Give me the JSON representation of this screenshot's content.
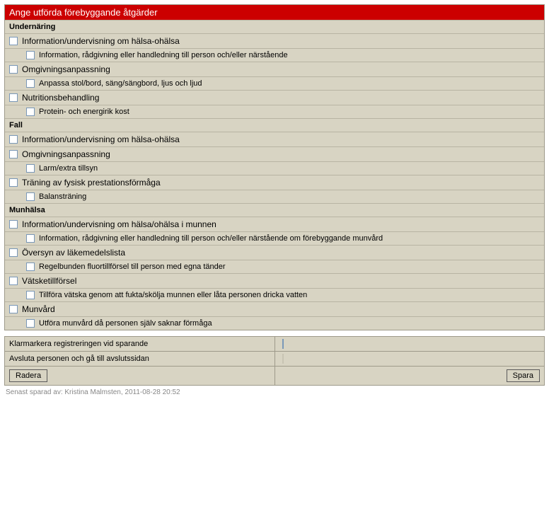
{
  "header": {
    "title": "Ange utförda förebyggande åtgärder"
  },
  "sections": {
    "undernaring": {
      "title": "Undernäring",
      "items": [
        {
          "label": "Information/undervisning om hälsa-ohälsa",
          "sub": [
            {
              "label": "Information, rådgivning eller handledning till person och/eller närstående"
            }
          ]
        },
        {
          "label": "Omgivningsanpassning",
          "sub": [
            {
              "label": "Anpassa stol/bord, säng/sängbord, ljus och ljud"
            }
          ]
        },
        {
          "label": "Nutritionsbehandling",
          "sub": [
            {
              "label": "Protein- och energirik kost"
            }
          ]
        }
      ]
    },
    "fall": {
      "title": "Fall",
      "items": [
        {
          "label": "Information/undervisning om hälsa-ohälsa",
          "sub": []
        },
        {
          "label": "Omgivningsanpassning",
          "sub": [
            {
              "label": "Larm/extra tillsyn"
            }
          ]
        },
        {
          "label": "Träning av fysisk prestationsförmåga",
          "sub": [
            {
              "label": "Balansträning"
            }
          ]
        }
      ]
    },
    "munhalsa": {
      "title": "Munhälsa",
      "items": [
        {
          "label": "Information/undervisning om hälsa/ohälsa i munnen",
          "sub": [
            {
              "label": "Information, rådgivning eller handledning till person och/eller närstående om förebyggande munvård"
            }
          ]
        },
        {
          "label": "Översyn av läkemedelslista",
          "sub": [
            {
              "label": "Regelbunden fluortillförsel till person med egna tänder"
            }
          ]
        },
        {
          "label": "Vätsketillförsel",
          "sub": [
            {
              "label": "Tillföra vätska genom att fukta/skölja munnen eller låta personen dricka vatten"
            }
          ]
        },
        {
          "label": "Munvård",
          "sub": [
            {
              "label": "Utföra munvård då personen själv saknar förmåga"
            }
          ]
        }
      ]
    }
  },
  "footer": {
    "option1": "Klarmarkera registreringen vid sparande",
    "option2": "Avsluta personen och gå till avslutssidan",
    "delete": "Radera",
    "save": "Spara"
  },
  "status": {
    "saved": "Senast sparad av: Kristina Malmsten, 2011-08-28 20:52"
  }
}
